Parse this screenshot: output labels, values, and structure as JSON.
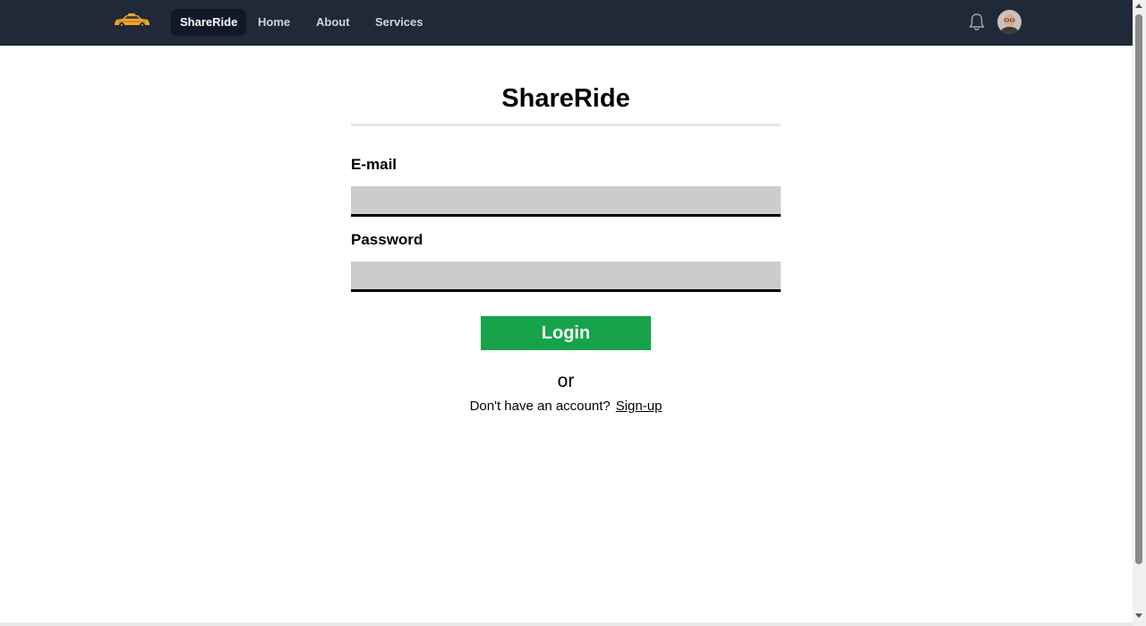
{
  "navbar": {
    "logo_icon": "taxi-car-logo",
    "links": [
      {
        "label": "ShareRide",
        "active": true
      },
      {
        "label": "Home",
        "active": false
      },
      {
        "label": "About",
        "active": false
      },
      {
        "label": "Services",
        "active": false
      }
    ],
    "notification_icon": "bell-icon",
    "avatar_icon": "user-avatar",
    "background_color": "#1f2937"
  },
  "login": {
    "title": "ShareRide",
    "email_label": "E-mail",
    "email_value": "",
    "password_label": "Password",
    "password_value": "",
    "submit_label": "Login",
    "or_text": "or",
    "signup_prompt": "Don't have an account?",
    "signup_link": "Sign-up",
    "button_color": "#16a34a",
    "input_color": "#cccccc"
  }
}
